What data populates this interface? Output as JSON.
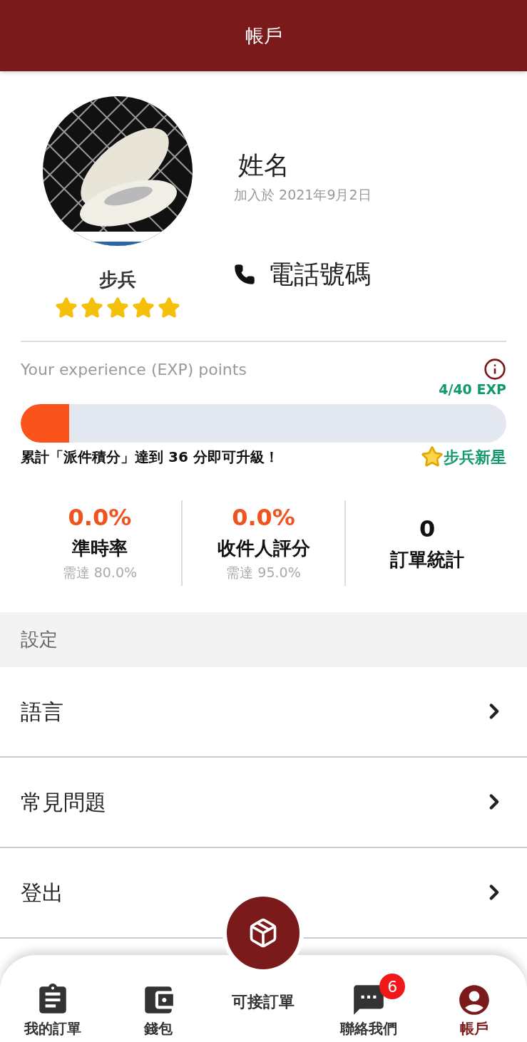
{
  "header": {
    "title": "帳戶"
  },
  "profile": {
    "name": "姓名",
    "joined": "加入於 2021年9月2日",
    "rank": "步兵",
    "stars": 5,
    "phone": "電話號碼"
  },
  "exp": {
    "label": "Your experience (EXP) points",
    "reading": "4/40 EXP",
    "level": 0.1,
    "hint": "累計「派件積分」達到 36 分即可升級！",
    "next_rank": "步兵新星"
  },
  "stats": [
    {
      "value": "0.0%",
      "label": "準時率",
      "target": "需達 80.0%",
      "kind": "percent"
    },
    {
      "value": "0.0%",
      "label": "收件人評分",
      "target": "需達 95.0%",
      "kind": "percent"
    },
    {
      "value": "0",
      "label": "訂單統計",
      "kind": "count"
    }
  ],
  "settings": {
    "title": "設定",
    "items": [
      "語言",
      "常見問題",
      "登出"
    ]
  },
  "nav": [
    {
      "label": "我的訂單",
      "kind": "orders",
      "selected": false
    },
    {
      "label": "錢包",
      "kind": "wallet",
      "selected": false
    },
    {
      "label": "可接訂單",
      "kind": "center",
      "selected": false
    },
    {
      "label": "聯絡我們",
      "kind": "chat",
      "selected": false,
      "badge": "6"
    },
    {
      "label": "帳戶",
      "kind": "account",
      "selected": true
    }
  ]
}
